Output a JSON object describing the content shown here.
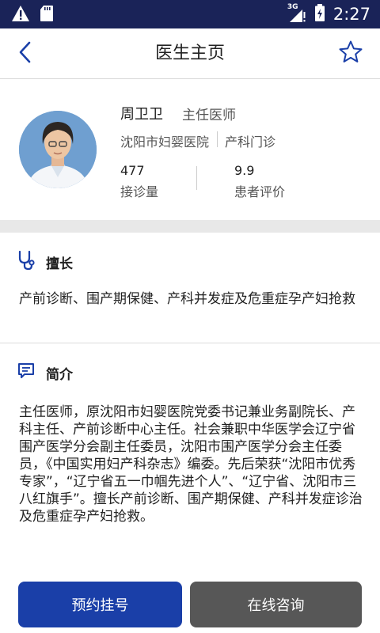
{
  "status_bar": {
    "time": "2:27",
    "network": "3G"
  },
  "header": {
    "title": "医生主页"
  },
  "doctor": {
    "name": "周卫卫",
    "title": "主任医师",
    "hospital": "沈阳市妇婴医院",
    "department": "产科门诊",
    "consultations_value": "477",
    "consultations_label": "接诊量",
    "rating_value": "9.9",
    "rating_label": "患者评价"
  },
  "specialty": {
    "heading": "擅长",
    "text": "产前诊断、围产期保健、产科并发症及危重症孕产妇抢救"
  },
  "intro": {
    "heading": "简介",
    "text": "主任医师，原沈阳市妇婴医院党委书记兼业务副院长、产科主任、产前诊断中心主任。社会兼职中华医学会辽宁省围产医学分会副主任委员，沈阳市围产医学分会主任委员，《中国实用妇产科杂志》编委。先后荣获“沈阳市优秀专家”，“辽宁省五一巾帼先进个人”、“辽宁省、沈阳市三八红旗手”。擅长产前诊断、围产期保健、产科并发症诊治及危重症孕产妇抢救。"
  },
  "actions": {
    "book_label": "预约挂号",
    "consult_label": "在线咨询"
  },
  "colors": {
    "status_bar": "#1a2358",
    "accent": "#1a3fa8",
    "secondary_button": "#575757",
    "section_gap": "#e8e8e8"
  }
}
